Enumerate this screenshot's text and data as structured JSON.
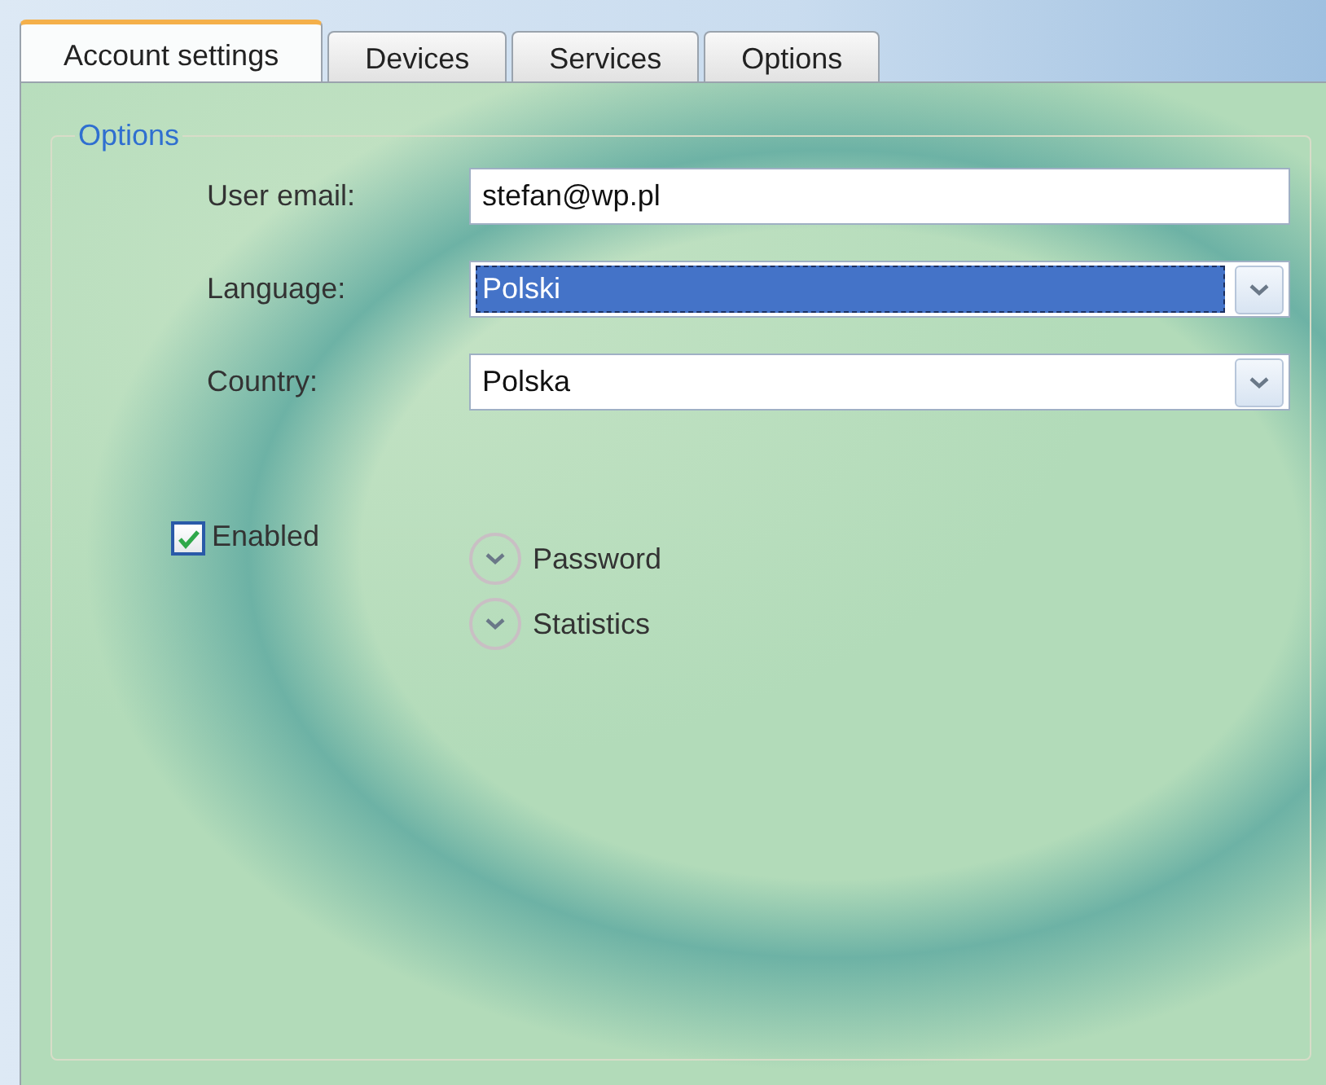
{
  "tabs": [
    {
      "label": "Account settings",
      "selected": true
    },
    {
      "label": "Devices",
      "selected": false
    },
    {
      "label": "Services",
      "selected": false
    },
    {
      "label": "Options",
      "selected": false
    }
  ],
  "group": {
    "title": "Options"
  },
  "fields": [
    {
      "label": "User email:",
      "kind": "text",
      "value": "stefan@wp.pl"
    },
    {
      "label": "Language:",
      "kind": "dropdown",
      "value": "Polski",
      "focused": true
    },
    {
      "label": "Country:",
      "kind": "dropdown",
      "value": "Polska",
      "focused": false
    }
  ],
  "enabled": {
    "label": "Enabled",
    "checked": true
  },
  "sections": [
    {
      "label": "Password",
      "expanded": false
    },
    {
      "label": "Statistics",
      "expanded": false
    }
  ]
}
